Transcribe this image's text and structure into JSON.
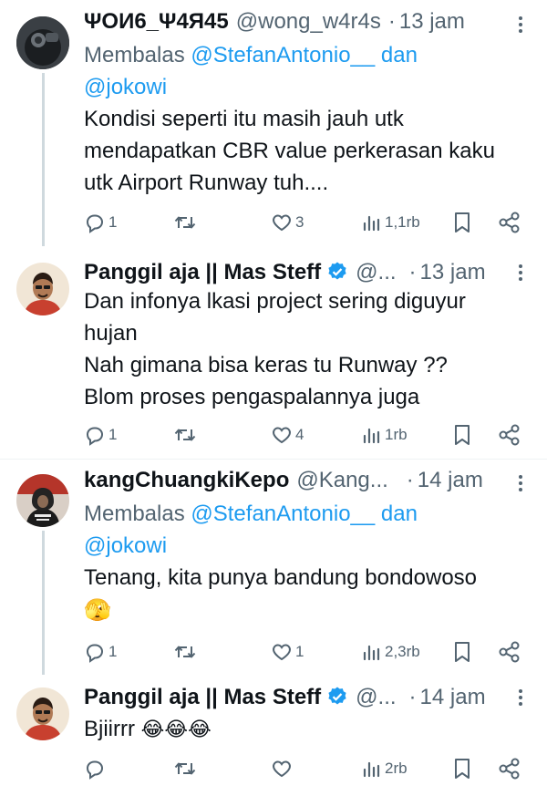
{
  "tweets": [
    {
      "name": "ΨОИ6_Ψ4Я45",
      "handle": "@wong_w4r4s",
      "time": "13 jam",
      "reply_prefix": "Membalas",
      "reply_user1": "@StefanAntonio__",
      "reply_and": "dan",
      "reply_user2": "@jokowi",
      "lines": [
        "Kondisi seperti itu masih jauh utk",
        "mendapatkan CBR value perkerasan kaku",
        "utk Airport Runway tuh...."
      ],
      "replies": "1",
      "retweets": "",
      "likes": "3",
      "views": "1,1rb"
    },
    {
      "name": "Panggil aja || Mas Steff",
      "handle": "@...",
      "time": "13 jam",
      "lines": [
        "Dan infonya lkasi project sering diguyur",
        "hujan",
        "Nah gimana bisa keras tu Runway ??",
        "Blom proses pengaspalannya juga"
      ],
      "replies": "1",
      "retweets": "",
      "likes": "4",
      "views": "1rb"
    },
    {
      "name": "kangChuangkiKepo",
      "handle": "@Kang...",
      "time": "14 jam",
      "reply_prefix": "Membalas",
      "reply_user1": "@StefanAntonio__",
      "reply_and": "dan",
      "reply_user2": "@jokowi",
      "lines": [
        "Tenang, kita punya bandung bondowoso"
      ],
      "emoji": "🫣",
      "replies": "1",
      "retweets": "",
      "likes": "1",
      "views": "2,3rb"
    },
    {
      "name": "Panggil aja || Mas Steff",
      "handle": "@...",
      "time": "14 jam",
      "lines": [
        "Bjiirrr"
      ],
      "emoji": "😂😂😂",
      "replies": "",
      "retweets": "",
      "likes": "",
      "views": "2rb"
    }
  ],
  "colors": {
    "text": "#0f1419",
    "secondary": "#536471",
    "link": "#1d9bf0",
    "verified": "#1d9bf0",
    "divider": "#eff3f4"
  }
}
